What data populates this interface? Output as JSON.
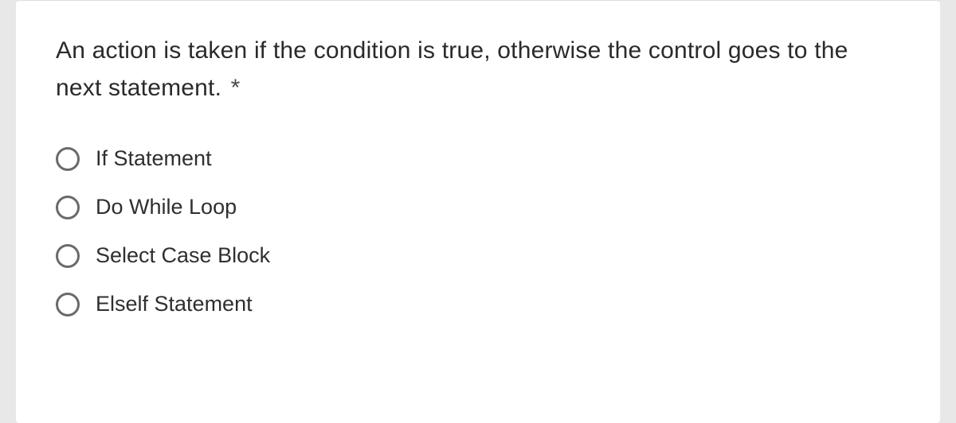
{
  "question": {
    "text": "An action is taken if the condition is true, otherwise the control goes to the next statement.",
    "required_mark": "*"
  },
  "options": [
    {
      "label": "If Statement"
    },
    {
      "label": "Do While Loop"
    },
    {
      "label": "Select Case Block"
    },
    {
      "label": "Elself Statement"
    }
  ]
}
